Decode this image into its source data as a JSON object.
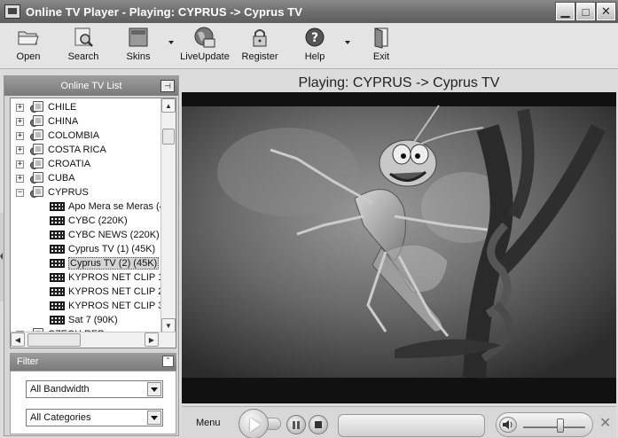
{
  "window": {
    "title": "Online TV Player - Playing: CYPRUS -> Cyprus TV",
    "min_symbol": "▁",
    "max_symbol": "□",
    "close_symbol": "✕"
  },
  "toolbar": {
    "open": "Open",
    "search": "Search",
    "skins": "Skins",
    "liveupdate": "LiveUpdate",
    "register": "Register",
    "help": "Help",
    "exit": "Exit"
  },
  "tv_list": {
    "header": "Online TV List",
    "pin_symbol": "⊣",
    "countries": [
      {
        "name": "CHILE",
        "expander": "+"
      },
      {
        "name": "CHINA",
        "expander": "+"
      },
      {
        "name": "COLOMBIA",
        "expander": "+"
      },
      {
        "name": "COSTA RICA",
        "expander": "+"
      },
      {
        "name": "CROATIA",
        "expander": "+"
      },
      {
        "name": "CUBA",
        "expander": "+"
      },
      {
        "name": "CYPRUS",
        "expander": "−"
      }
    ],
    "channels": [
      "Apo Mera se Meras (4",
      "CYBC (220K)",
      "CYBC NEWS (220K)",
      "Cyprus TV (1) (45K)",
      "Cyprus TV (2) (45K)",
      "KYPROS NET CLIP 1",
      "KYPROS NET CLIP 2",
      "KYPROS NET CLIP 3",
      "Sat 7 (90K)"
    ],
    "selected_channel": "Cyprus TV (2) (45K)",
    "next_country": {
      "name": "CZECH REP",
      "expander": "+"
    }
  },
  "filter": {
    "header": "Filter",
    "collapse_symbol": "⌃",
    "bandwidth": "All Bandwidth",
    "categories": "All Categories"
  },
  "player": {
    "now_playing": "Playing: CYPRUS -> Cyprus TV",
    "menu_label": "Menu",
    "volume_level": 0.6,
    "close_symbol": "✕"
  }
}
